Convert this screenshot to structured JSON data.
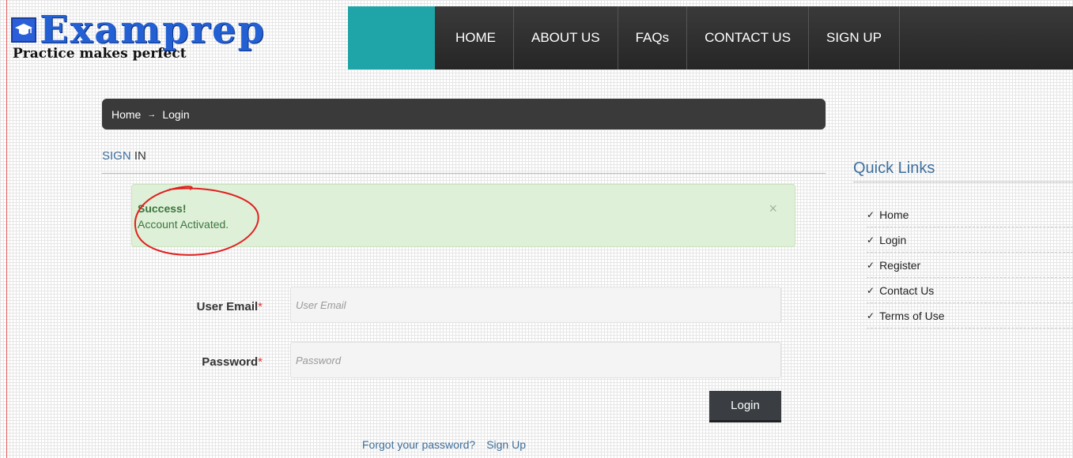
{
  "logo": {
    "name": "Examprep",
    "tagline": "Practice makes perfect"
  },
  "nav": {
    "items": [
      {
        "label": "HOME"
      },
      {
        "label": "ABOUT US"
      },
      {
        "label": "FAQs"
      },
      {
        "label": "CONTACT US"
      },
      {
        "label": "SIGN UP"
      }
    ]
  },
  "breadcrumb": {
    "home": "Home",
    "separator": "→",
    "current": "Login"
  },
  "signin": {
    "title_a": "SIGN",
    "title_b": "IN"
  },
  "alert": {
    "title": "Success!",
    "message": "Account Activated.",
    "close": "×"
  },
  "form": {
    "email_label": "User Email",
    "email_placeholder": "User Email",
    "password_label": "Password",
    "password_placeholder": "Password",
    "required_mark": "*",
    "login_label": "Login",
    "forgot_label": "Forgot your password?",
    "signup_label": "Sign Up"
  },
  "quick_links": {
    "title": "Quick Links",
    "check": "✓",
    "items": [
      {
        "label": "Home"
      },
      {
        "label": "Login"
      },
      {
        "label": "Register"
      },
      {
        "label": "Contact Us"
      },
      {
        "label": "Terms of Use"
      }
    ]
  },
  "colors": {
    "nav_bg": "#2c2c2c",
    "teal": "#1fa5a7",
    "logo_blue": "#2360d4",
    "link_blue": "#3d6f9c",
    "alert_bg": "#dff0d8",
    "alert_text": "#3c763d",
    "annotation_red": "#e02020"
  }
}
